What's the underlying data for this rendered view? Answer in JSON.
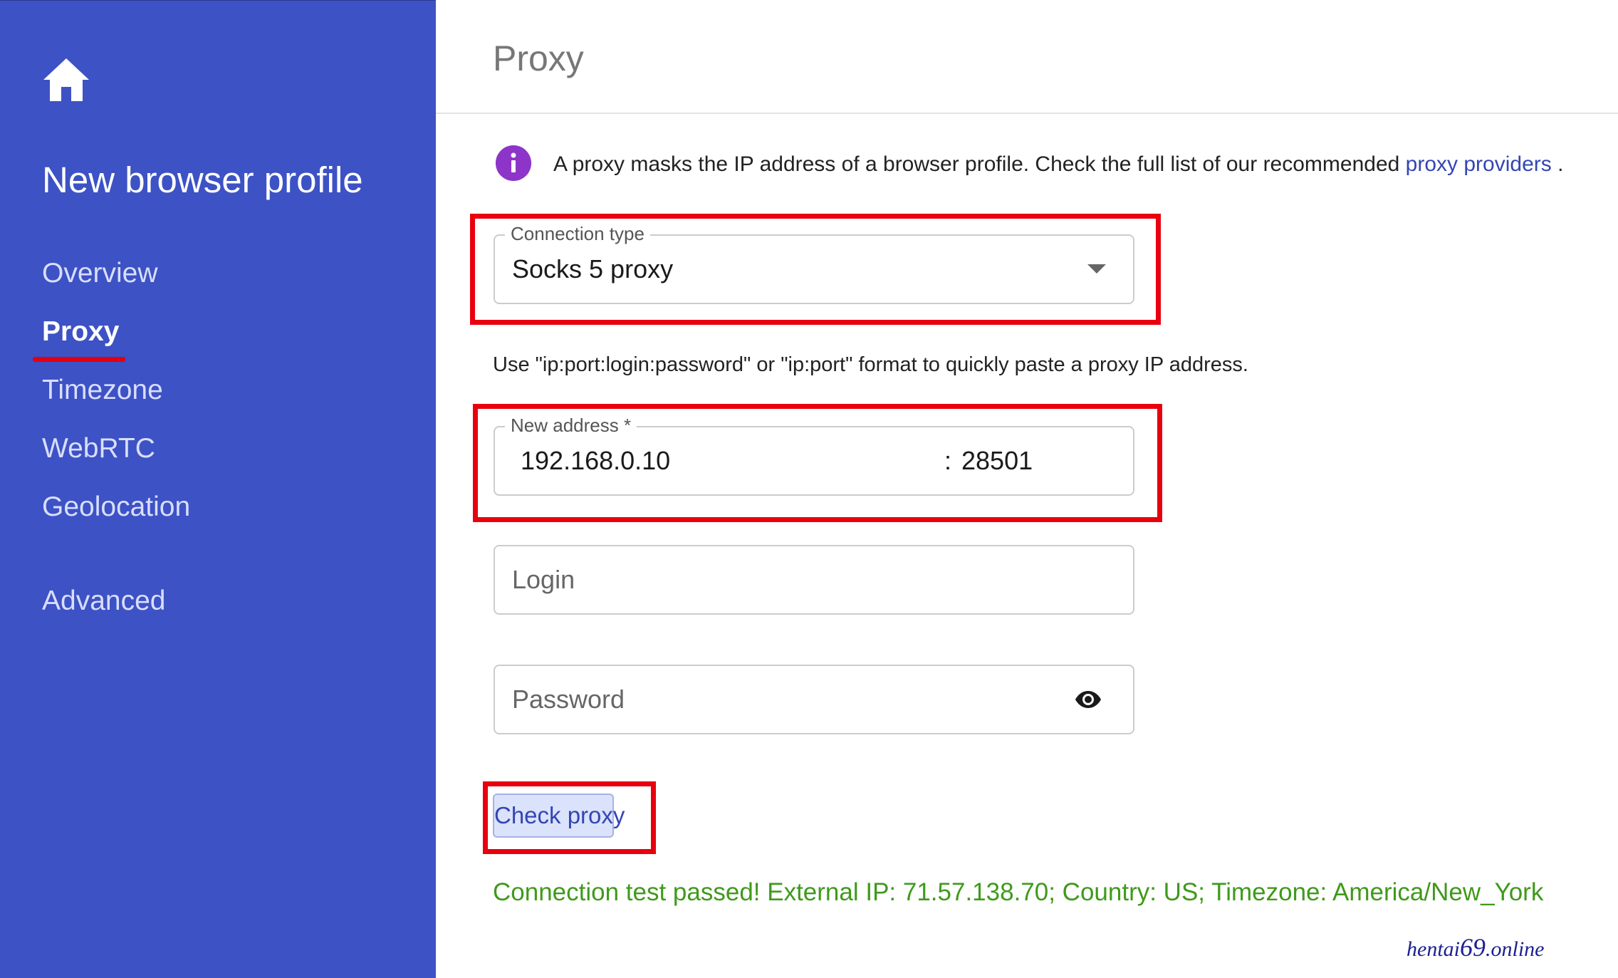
{
  "sidebar": {
    "title": "New browser profile",
    "items": [
      {
        "label": "Overview",
        "active": false
      },
      {
        "label": "Proxy",
        "active": true
      },
      {
        "label": "Timezone",
        "active": false
      },
      {
        "label": "WebRTC",
        "active": false
      },
      {
        "label": "Geolocation",
        "active": false
      },
      {
        "label": "Advanced",
        "active": false
      }
    ],
    "home_icon": "home-icon"
  },
  "header": {
    "title": "Proxy"
  },
  "info": {
    "icon": "info-icon",
    "text": "A proxy masks the IP address of a browser profile. Check the full list of our recommended ",
    "link_text": "proxy providers",
    "suffix": " ."
  },
  "connection_type": {
    "label": "Connection type",
    "value": "Socks 5 proxy"
  },
  "hint": "Use \"ip:port:login:password\" or \"ip:port\" format to quickly paste a proxy IP address.",
  "address": {
    "label": "New address *",
    "ip": "192.168.0.10",
    "separator": ":",
    "port": "28501"
  },
  "login": {
    "placeholder": "Login"
  },
  "password": {
    "placeholder": "Password",
    "icon": "eye-icon"
  },
  "check_button": {
    "label": "Check proxy"
  },
  "result": "Connection test passed! External IP: 71.57.138.70; Country: US; Timezone: America/New_York",
  "watermark": {
    "prefix": "hentai",
    "number": "69",
    "suffix": ".online"
  },
  "colors": {
    "sidebar_bg": "#3d52c4",
    "highlight": "#e8000f",
    "success": "#3f9a1b",
    "link": "#3446b3",
    "info_icon": "#8e35c9"
  }
}
